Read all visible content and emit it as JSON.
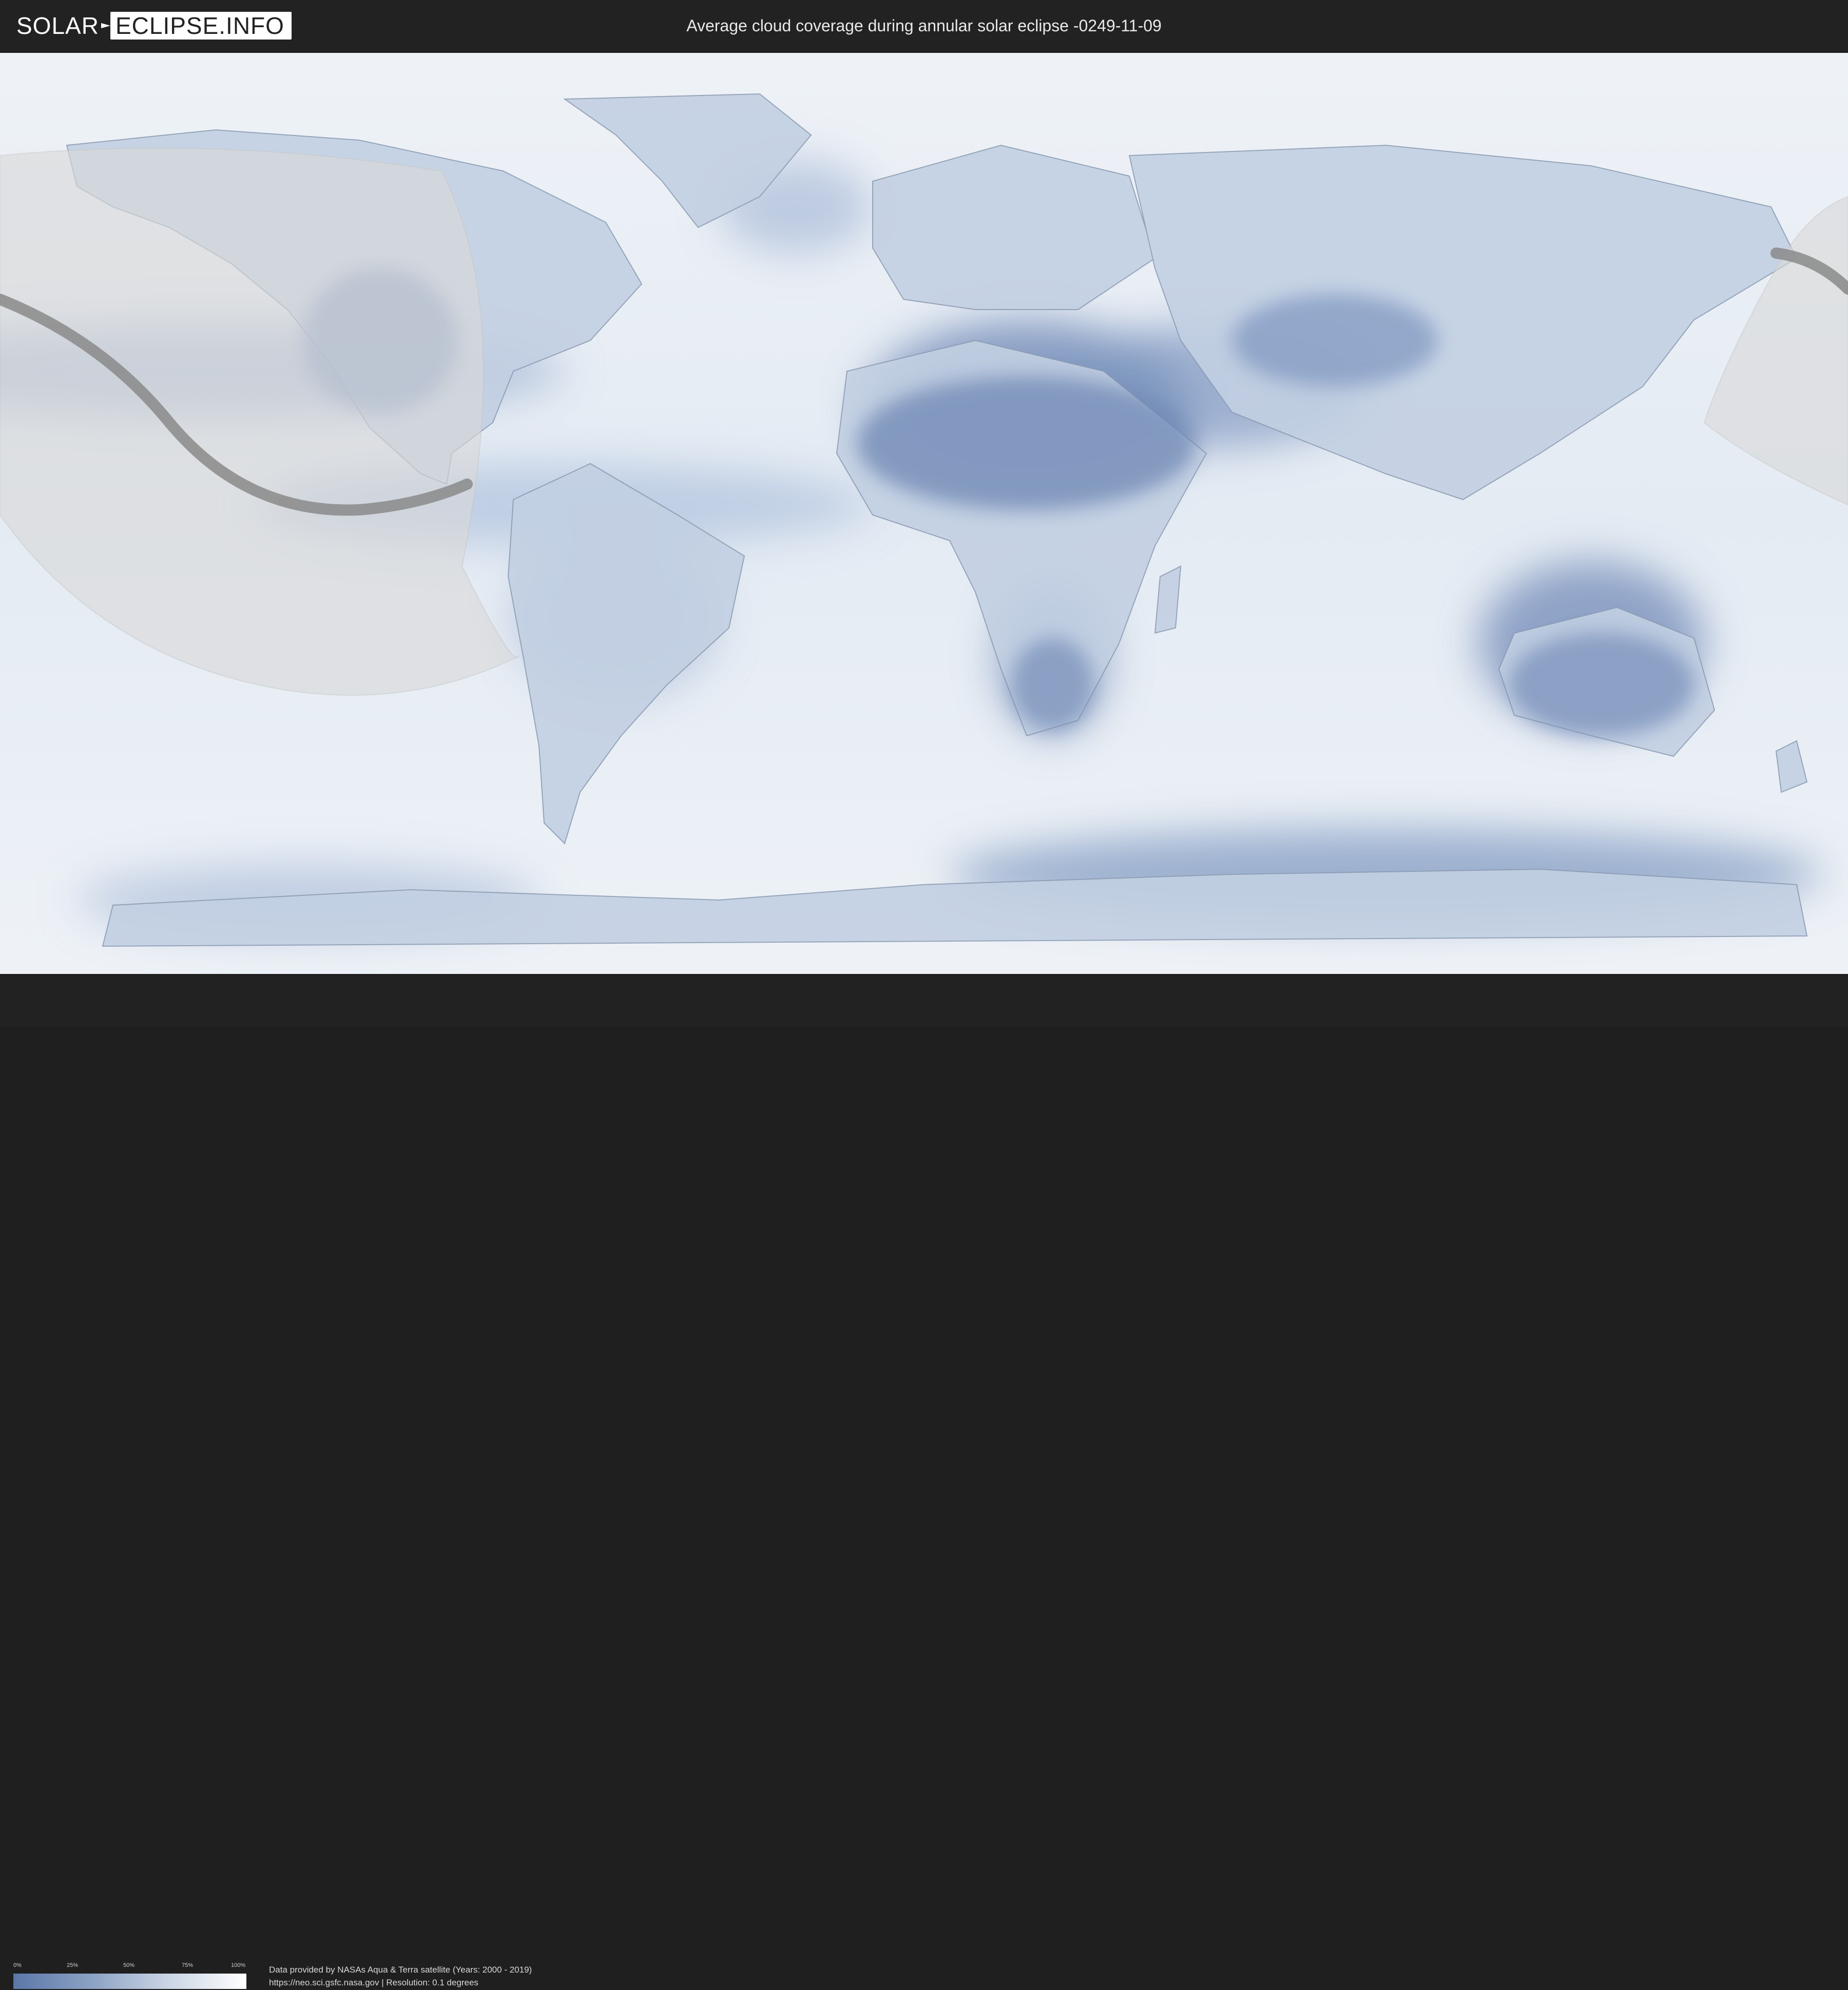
{
  "header": {
    "logo_left": "SOLAR",
    "logo_right": "ECLIPSE.INFO",
    "title": "Average cloud coverage during annular solar eclipse -0249-11-09"
  },
  "legend": {
    "ticks": [
      "0%",
      "25%",
      "50%",
      "75%",
      "100%"
    ],
    "colors": [
      "#5b77a8",
      "#ffffff"
    ]
  },
  "credits": {
    "line1": "Data provided by NASAs Aqua & Terra satellite (Years: 2000 - 2019)",
    "line2": "https://neo.sci.gsfc.nasa.gov | Resolution: 0.1 degrees"
  },
  "colors": {
    "background": "#222222",
    "ocean": "#dfe6ef",
    "cloud_low": "#5b77a8",
    "eclipse_overlay": "#d9d9d9",
    "eclipse_path": "#8a8a8a"
  }
}
